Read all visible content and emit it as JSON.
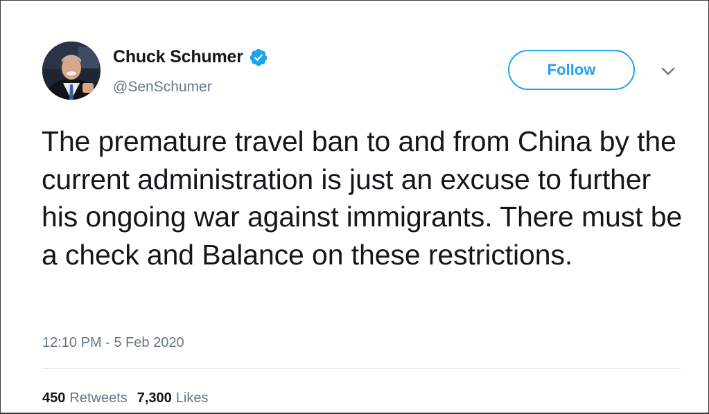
{
  "tweet": {
    "author": {
      "display_name": "Chuck Schumer",
      "handle": "@SenSchumer",
      "verified": true,
      "avatar_icon": "profile-photo"
    },
    "follow_label": "Follow",
    "menu_icon": "chevron-down-icon",
    "text": "The premature travel ban to and from China by the current administration is just an excuse to further his ongoing war against immigrants. There must be a check and Balance on these restrictions.",
    "timestamp": "12:10 PM - 5 Feb 2020",
    "stats": {
      "retweets_count": "450",
      "retweets_label": "Retweets",
      "likes_count": "7,300",
      "likes_label": "Likes"
    }
  },
  "colors": {
    "accent": "#1da1f2",
    "text_primary": "#14171a",
    "text_secondary": "#657786",
    "divider": "#e1e8ed"
  }
}
